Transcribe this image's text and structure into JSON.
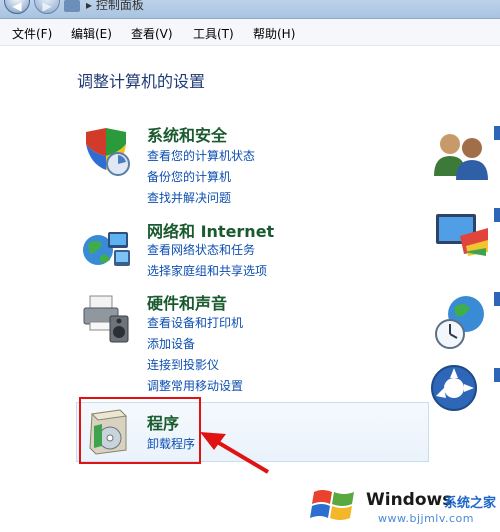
{
  "breadcrumb": "▸ 控制面板",
  "menu": [
    "文件(F)",
    "编辑(E)",
    "查看(V)",
    "工具(T)",
    "帮助(H)"
  ],
  "page_title": "调整计算机的设置",
  "categories": [
    {
      "title": "系统和安全",
      "links": [
        "查看您的计算机状态",
        "备份您的计算机",
        "查找并解决问题"
      ]
    },
    {
      "title": "网络和 Internet",
      "links": [
        "查看网络状态和任务",
        "选择家庭组和共享选项"
      ]
    },
    {
      "title": "硬件和声音",
      "links": [
        "查看设备和打印机",
        "添加设备",
        "连接到投影仪",
        "调整常用移动设置"
      ]
    },
    {
      "title": "程序",
      "links": [
        "卸载程序"
      ]
    }
  ],
  "watermark": {
    "brand": "Windows",
    "cn": "系统之家",
    "url": "www.bjjmlv.com"
  }
}
